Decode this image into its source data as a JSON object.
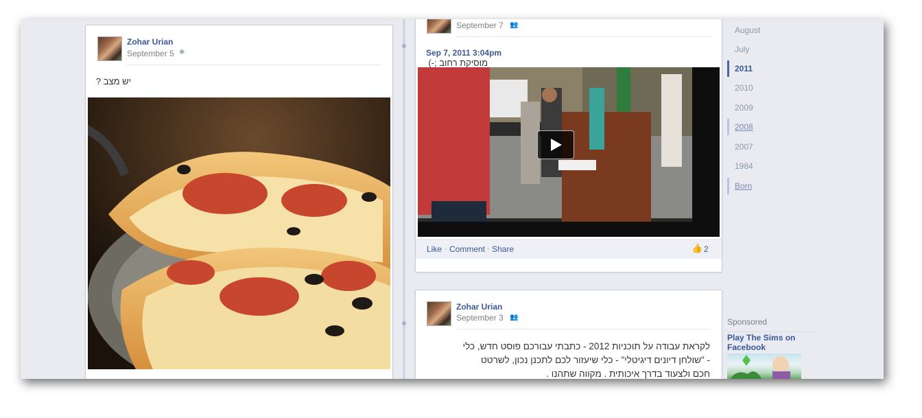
{
  "post_left": {
    "author": "Zohar Urian",
    "date": "September 5",
    "text": "יש מצב ?",
    "photo_icon": "pizza-photo"
  },
  "post_video": {
    "date": "September 7",
    "timestamp": "Sep 7, 2011 3:04pm",
    "text": "מוסיקת רחוב ;-)",
    "actions": {
      "like": "Like",
      "comment": "Comment",
      "share": "Share"
    },
    "like_count": "2"
  },
  "post_lower": {
    "author": "Zohar Urian",
    "date": "September 3",
    "text_lines": [
      "לקראת עבודה על תוכניות 2012 - כתבתי עבורכם פוסט חדש, כלי",
      "- \"שולחן דיונים דיגיטלי\" - כלי שיעזור לכם לתכנן נכון, לשרטט",
      "חכם ולצעוד בדרך איכותית . מקווה שתהנו ."
    ]
  },
  "timeline_years": [
    {
      "label": "August",
      "state": "normal"
    },
    {
      "label": "July",
      "state": "normal"
    },
    {
      "label": "2011",
      "state": "active"
    },
    {
      "label": "2010",
      "state": "normal"
    },
    {
      "label": "2009",
      "state": "normal"
    },
    {
      "label": "2008",
      "state": "marked-underline"
    },
    {
      "label": "2007",
      "state": "normal"
    },
    {
      "label": "1984",
      "state": "normal"
    },
    {
      "label": "Born",
      "state": "marked-underline"
    }
  ],
  "sponsored": {
    "label": "Sponsored",
    "ad_title": "Play The Sims on Facebook"
  },
  "colors": {
    "link_blue": "#3b5998",
    "background": "#e9ebf0",
    "active_year_bar": "#4c66a4"
  }
}
